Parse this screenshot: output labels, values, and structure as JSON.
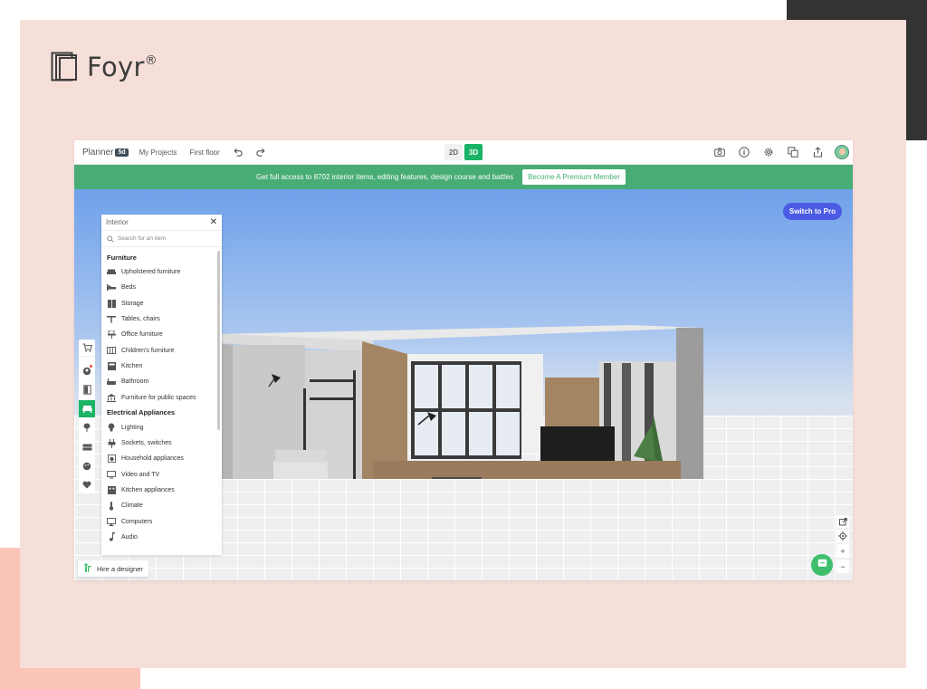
{
  "brand": {
    "name": "Foyr",
    "mark": "®"
  },
  "topbar": {
    "app_name": "Planner",
    "app_badge": "5d",
    "my_projects": "My Projects",
    "floor": "First floor",
    "view_2d": "2D",
    "view_3d": "3D",
    "active_view": "3D",
    "icons": [
      "camera-icon",
      "info-icon",
      "gear-icon",
      "layers-icon",
      "share-icon",
      "avatar"
    ]
  },
  "promo": {
    "text": "Get full access to 8702 interior items, editing features, design course and battles",
    "button": "Become A Premium Member"
  },
  "viewport": {
    "switch_pro": "Switch to Pro",
    "hire": "Hire a designer"
  },
  "panel": {
    "title": "Interior",
    "search_placeholder": "Search for an item",
    "categories": [
      {
        "name": "Furniture",
        "items": [
          "Upholstered furniture",
          "Beds",
          "Storage",
          "Tables, chairs",
          "Office furniture",
          "Children's furniture",
          "Kitchen",
          "Bathroom",
          "Furniture for public spaces"
        ]
      },
      {
        "name": "Electrical Appliances",
        "items": [
          "Lighting",
          "Sockets, switches",
          "Household appliances",
          "Video and TV",
          "Kitchen appliances",
          "Climate",
          "Computers",
          "Audio"
        ]
      }
    ]
  },
  "colors": {
    "green_accent": "#1bb365",
    "promo_bar": "#48ad74",
    "pro_button": "#4b5be3",
    "pink_background": "#f6dfd9"
  }
}
